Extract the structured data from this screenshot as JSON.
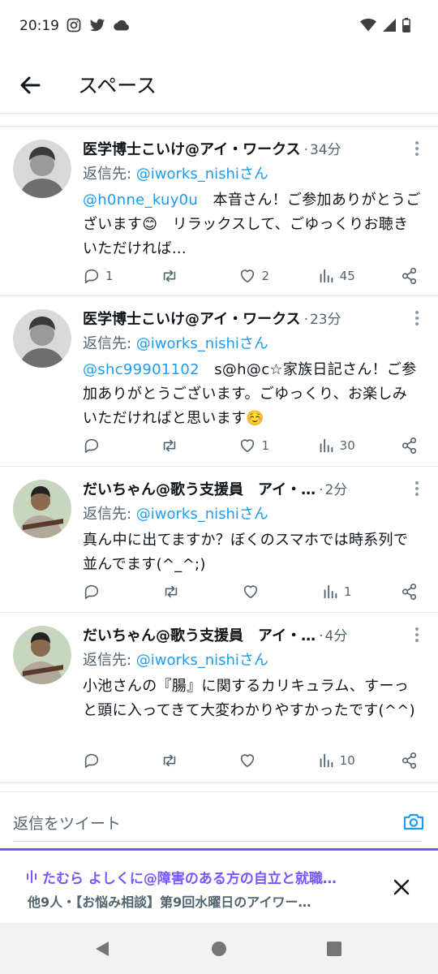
{
  "status_bar": {
    "time": "20:19",
    "left_icons": [
      "instagram-icon",
      "twitter-icon",
      "cloud-icon"
    ],
    "right_icons": [
      "wifi-icon",
      "signal-icon",
      "battery-icon"
    ]
  },
  "header": {
    "title": "スペース",
    "back_icon": "arrow-left-icon"
  },
  "tweets": [
    {
      "name": "医学博士こいけ@アイ・ワークス",
      "time": "34分",
      "reply_prefix": "返信先: ",
      "reply_handle": "@iworks_nishiさん",
      "mention": "@h0nne_kuy0u",
      "text": "　本音さん！ご参加ありがとうございます😊　リラックスして、ごゆっくりお聴きいただければ…",
      "replies": "1",
      "retweets": "",
      "likes": "2",
      "views": "45"
    },
    {
      "name": "医学博士こいけ@アイ・ワークス",
      "time": "23分",
      "reply_prefix": "返信先: ",
      "reply_handle": "@iworks_nishiさん",
      "mention": "@shc99901102",
      "text": "　s@h@c☆家族日記さん！ご参加ありがとうございます。ごゆっくり、お楽しみいただければと思います☺️",
      "replies": "",
      "retweets": "",
      "likes": "1",
      "views": "30"
    },
    {
      "name": "だいちゃん@歌う支援員　アイ・…",
      "time": "2分",
      "reply_prefix": "返信先: ",
      "reply_handle": "@iworks_nishiさん",
      "mention": "",
      "text": "真ん中に出てますか？ぼくのスマホでは時系列で並んでます(^_^;)",
      "replies": "",
      "retweets": "",
      "likes": "",
      "views": "1"
    },
    {
      "name": "だいちゃん@歌う支援員　アイ・…",
      "time": "4分",
      "reply_prefix": "返信先: ",
      "reply_handle": "@iworks_nishiさん",
      "mention": "",
      "text": "小池さんの『腸』に関するカリキュラム、すーっと頭に入ってきて大変わかりやすかったです(^^)",
      "replies": "",
      "retweets": "",
      "likes": "",
      "views": "10"
    }
  ],
  "reply_box": {
    "placeholder": "返信をツイート",
    "camera_icon": "camera-icon"
  },
  "space_bar": {
    "title": "たむら よしくに@障害のある方の自立と就職…",
    "subtitle": "他9人・【お悩み相談】第9回水曜日のアイワー…",
    "accent": "#7856ff"
  },
  "colors": {
    "link": "#1d9bf0",
    "muted": "#536471",
    "text": "#0f1419"
  }
}
